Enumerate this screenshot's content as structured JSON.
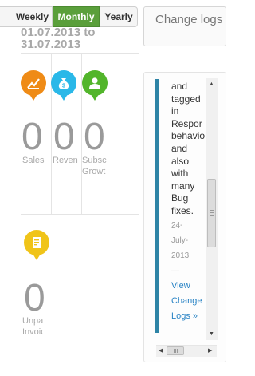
{
  "period_toggle": {
    "weekly": "Weekly",
    "monthly": "Monthly",
    "yearly": "Yearly",
    "selected": "Monthly"
  },
  "date_range": "01.07.2013 to 31.07.2013",
  "stats": [
    {
      "label": "Sales",
      "value": "0",
      "icon": "chart-icon",
      "color": "#ef8b16"
    },
    {
      "label": "Reven",
      "value": "0",
      "icon": "money-bag-icon",
      "color": "#2ab8e8"
    },
    {
      "label": "Subsc Growt",
      "value": "0",
      "icon": "user-icon",
      "color": "#52b52b"
    },
    {
      "label": "Unpai Invoic",
      "value": "0",
      "icon": "invoice-icon",
      "color": "#f0c419"
    }
  ],
  "change_logs": {
    "button_label": "Change logs",
    "entry_lines": [
      "and",
      "tagged",
      "in",
      "Respor",
      "behavio",
      "and",
      "also",
      "with",
      "many",
      "Bug",
      "fixes."
    ],
    "date": "24-July-2013",
    "separator": "—",
    "link_lines": [
      "View",
      "Change",
      "Logs »"
    ]
  },
  "colors": {
    "accent_green": "#5a9f3b",
    "log_accent": "#2e84a6",
    "link": "#2a84c5"
  }
}
